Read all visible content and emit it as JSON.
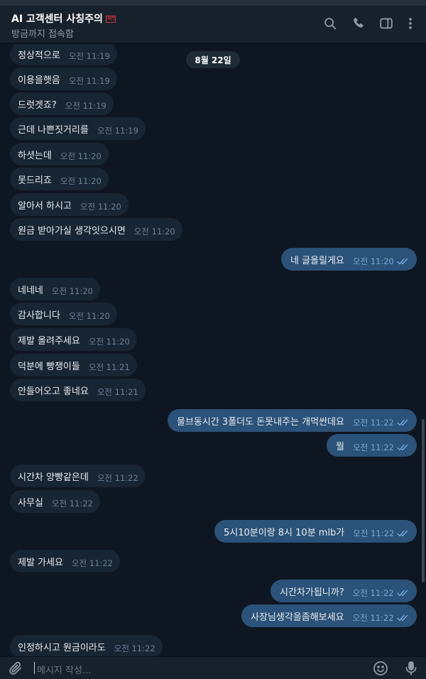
{
  "header": {
    "title": "AI 고객센터 사칭주의",
    "badge": "사기",
    "status": "방금까지 접속함"
  },
  "date_label": "8월 22일",
  "messages": [
    {
      "dir": "in",
      "text": "정상적으로",
      "time": "오전 11:19"
    },
    {
      "dir": "in",
      "text": "이용을햇음",
      "time": "오전 11:19"
    },
    {
      "dir": "in",
      "text": "드럿겟죠?",
      "time": "오전 11:19"
    },
    {
      "dir": "in",
      "text": "근데 나쁜짓거리를",
      "time": "오전 11:19"
    },
    {
      "dir": "in",
      "text": "하셧는데",
      "time": "오전 11:20"
    },
    {
      "dir": "in",
      "text": "못드리죠",
      "time": "오전 11:20"
    },
    {
      "dir": "in",
      "text": "알아서 하시고",
      "time": "오전 11:20"
    },
    {
      "dir": "in",
      "text": "원금 받아가실 생각잇으시면",
      "time": "오전 11:20"
    },
    {
      "dir": "out",
      "text": "네 글올릴게요",
      "time": "오전 11:20"
    },
    {
      "dir": "in",
      "text": "네네네",
      "time": "오전 11:20"
    },
    {
      "dir": "in",
      "text": "감사합니다",
      "time": "오전 11:20"
    },
    {
      "dir": "in",
      "text": "제발 올려주세요",
      "time": "오전 11:20"
    },
    {
      "dir": "in",
      "text": "덕분에 빵쟁이들",
      "time": "오전 11:21"
    },
    {
      "dir": "in",
      "text": "안들어오고 좋네요",
      "time": "오전 11:21"
    },
    {
      "dir": "out",
      "text": "물브동시간 3폴더도 돈못내주는 개먹싼데요",
      "time": "오전 11:22"
    },
    {
      "dir": "out",
      "text": "뭘",
      "time": "오전 11:22"
    },
    {
      "dir": "in",
      "text": "시간차 양빵같은데",
      "time": "오전 11:22"
    },
    {
      "dir": "in",
      "text": "사무실",
      "time": "오전 11:22"
    },
    {
      "dir": "out",
      "text": "5시10분이랑 8시 10분 mlb가",
      "time": "오전 11:22"
    },
    {
      "dir": "in",
      "text": "제발 가세요",
      "time": "오전 11:22"
    },
    {
      "dir": "out",
      "text": "시간차가됩니까?",
      "time": "오전 11:22"
    },
    {
      "dir": "out",
      "text": "사장님생각을좀해보세요",
      "time": "오전 11:22"
    },
    {
      "dir": "in",
      "text": "인정하시고 원금이라도",
      "time": "오전 11:22"
    }
  ],
  "composer": {
    "placeholder": "메시지 작성..."
  },
  "icons": {
    "header": [
      "search-icon",
      "phone-icon",
      "sidebar-toggle-icon",
      "more-vertical-icon"
    ],
    "composer": [
      "attach-icon",
      "emoji-icon",
      "microphone-icon"
    ]
  },
  "colors": {
    "background": "#0e1621",
    "header": "#17212b",
    "incoming_bubble": "#182533",
    "outgoing_bubble": "#2b5278",
    "read_check": "#6fa8e2",
    "scam_badge": "#e0343b"
  }
}
